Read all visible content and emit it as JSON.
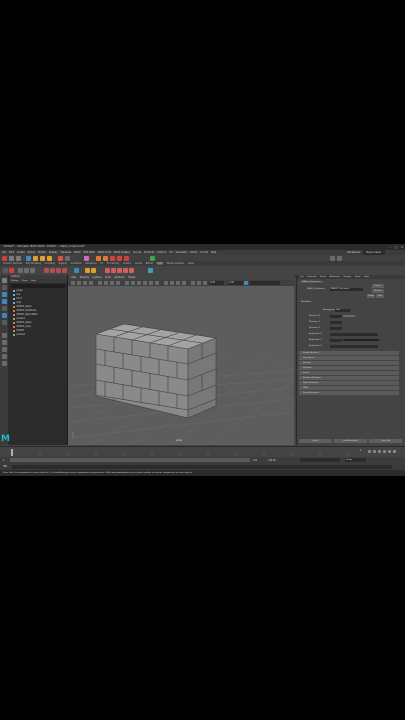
{
  "window": {
    "title": "untitled* - Autodesk MAYA 2020: untitled --- Mesh_Component*"
  },
  "menus": [
    "File",
    "Edit",
    "Create",
    "Select",
    "Modify",
    "Display",
    "Windows",
    "Mesh",
    "Edit Mesh",
    "Mesh Tools",
    "Mesh Display",
    "Curves",
    "Surfaces",
    "Deform",
    "UV",
    "Generate",
    "Cache",
    "Arnold",
    "Help"
  ],
  "workspace": {
    "label": "Workspace:",
    "value": "Maya Classic"
  },
  "shelf_tabs": [
    "Curves / Surfaces",
    "Poly Modeling",
    "Sculpting",
    "Rigging",
    "Animation",
    "Rendering",
    "FX",
    "FX Caching",
    "Custom",
    "Arnold",
    "Bifrost",
    "MASH",
    "Motion Graphics",
    "XGen"
  ],
  "outliner": {
    "title": "Outliner",
    "menu": [
      "Display",
      "Show",
      "Help"
    ],
    "items": [
      "persp",
      "top",
      "front",
      "side",
      "MASH1_Repro",
      "MASH1_Distribute",
      "MASH1_ReproMesh",
      "pCube1",
      "MASH1_Repro",
      "MASH1_Copy",
      "MASH1",
      "pCube2"
    ]
  },
  "viewport": {
    "menu": [
      "View",
      "Shading",
      "Lighting",
      "Show",
      "Renderer",
      "Panels"
    ],
    "camera_label": "persp",
    "field_value": "0.00",
    "field_value2": "1.00"
  },
  "attribute_editor": {
    "tabs": [
      "List",
      "Selected",
      "Focus",
      "Attributes",
      "Display",
      "Show",
      "Help"
    ],
    "node_tab": "MASH_Distribute1",
    "node_label": "MASH_Distribute:",
    "node_value": "MASH1_Distribute",
    "buttons": [
      "Focus",
      "Presets",
      "Show",
      "Hide"
    ],
    "section_main": "Distribute",
    "labels": [
      "Arrangement",
      "Grid",
      "Distance X",
      "Distance Y",
      "Distance Z",
      "Amplitude X",
      "Amplitude Y",
      "Amplitude Z"
    ],
    "sections": [
      "Enable Buttons",
      "Transforms",
      "Setting",
      "Rotation",
      "Scale",
      "Random Rotation",
      "Node Behavior",
      "UUID",
      "Extra Attributes"
    ],
    "bottom_buttons": [
      "Select",
      "Load Attributes",
      "Copy Tab"
    ]
  },
  "timeline": {
    "start": "1",
    "end": "120",
    "range_start": "1.00",
    "range_end": "120.00",
    "fps": "24 fps"
  },
  "command": {
    "label": "MEL"
  },
  "help_line": "Move Tool: Use manipulator to move object(s). Ctrl+middle-drag to move components along normals. Shift+drag manipulator axis or plane handles to extrude components or clone objects."
}
